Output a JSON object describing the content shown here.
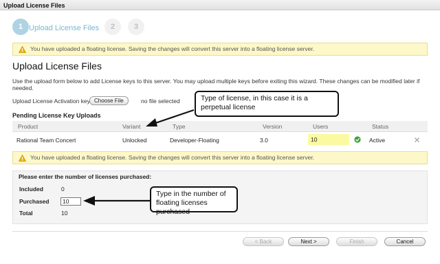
{
  "window": {
    "title": "Upload License Files"
  },
  "wizard": {
    "steps": [
      {
        "number": "1",
        "label": "Upload License Files"
      },
      {
        "number": "2"
      },
      {
        "number": "3"
      }
    ]
  },
  "warning_text": "You have uploaded a floating license. Saving the changes will convert this server into a floating license server.",
  "page": {
    "heading": "Upload License Files",
    "description": "Use the upload form below to add License keys to this server. You may upload multiple keys before exiting this wizard. These changes can be modified later if needed.",
    "activation_key_label": "Upload License Activation key:",
    "choose_file_label": "Choose File",
    "no_file_text": "no file selected"
  },
  "pending": {
    "title": "Pending License Key Uploads",
    "columns": [
      "Product",
      "Variant",
      "Type",
      "Version",
      "Users",
      "Status"
    ],
    "rows": [
      {
        "product": "Rational Team Concert",
        "variant": "Unlocked",
        "type": "Developer-Floating",
        "version": "3.0",
        "users": "10",
        "status": "Active",
        "remove_icon": "x-icon"
      }
    ]
  },
  "purchase": {
    "prompt": "Please enter the number of licenses purchased:",
    "included_label": "Included",
    "included_value": "0",
    "purchased_label": "Purchased",
    "purchased_value": "10",
    "total_label": "Total",
    "total_value": "10"
  },
  "callouts": {
    "variant_note": "Type of license, in this case it is a perpetual license",
    "purchased_note": "Type in the number of floating licenses purchased"
  },
  "buttons": {
    "back": "< Back",
    "next": "Next >",
    "finish": "Finish",
    "cancel": "Cancel"
  },
  "colors": {
    "accent": "#79b7cf",
    "warning_bg": "#fdf8c9",
    "highlight_cell": "#fcfaa0",
    "status_ok": "#3aa435"
  }
}
